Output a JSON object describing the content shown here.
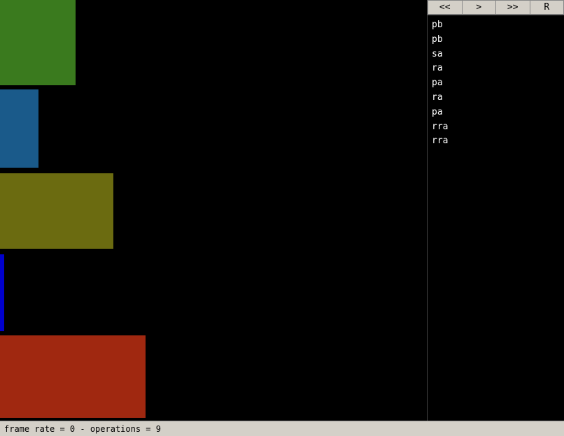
{
  "sidebar": {
    "controls": {
      "prev_prev_label": "<<",
      "prev_label": ">",
      "next_label": ">>",
      "reset_label": "R"
    },
    "operations": [
      "pb",
      "pb",
      "sa",
      "ra",
      "pa",
      "ra",
      "pa",
      "rra",
      "rra"
    ]
  },
  "status_bar": {
    "text": "frame rate = 0 - operations = 9"
  },
  "blocks": [
    {
      "id": "block-green",
      "color": "#3a7a1e"
    },
    {
      "id": "block-blue",
      "color": "#1a5a8a"
    },
    {
      "id": "block-olive",
      "color": "#6b6b10"
    },
    {
      "id": "block-thin-blue",
      "color": "#0000cc"
    },
    {
      "id": "block-red",
      "color": "#a02810"
    }
  ]
}
